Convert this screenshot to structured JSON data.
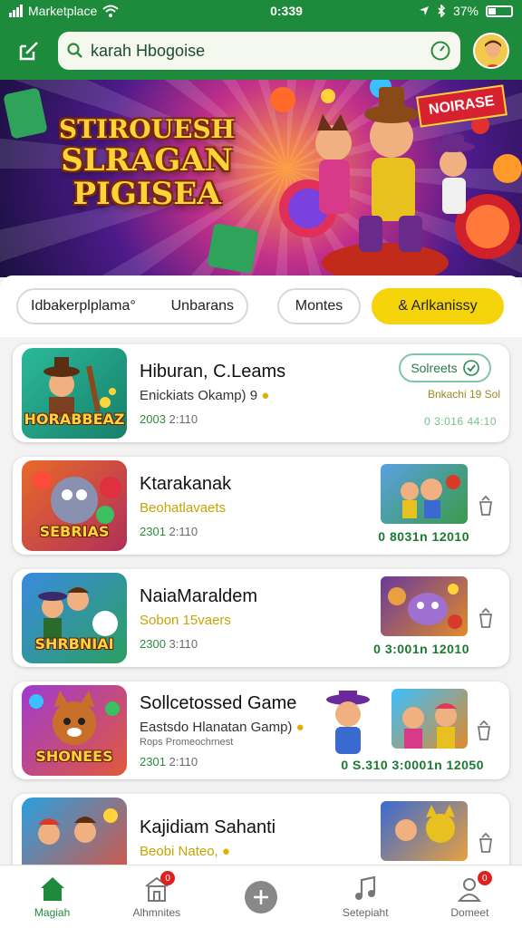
{
  "status_bar": {
    "carrier": "Marketplace",
    "time": "0:339",
    "battery": "37%"
  },
  "header": {
    "search_value": "karah Hbogoise",
    "search_placeholder": "Search"
  },
  "banner": {
    "title_line1": "STIROUESH",
    "title_line2": "SLRAGAN",
    "title_line3": "PIGISEA",
    "tag": "NOIRASE"
  },
  "filters": [
    {
      "label": "Idbakerplplama°",
      "extra": "Unbarans"
    },
    {
      "label": "Montes"
    },
    {
      "label": "& Arlkanissy"
    }
  ],
  "cards": [
    {
      "title": "Hiburan, C.Leams",
      "subtitle": "Enickiats Okamp) 9",
      "meta_date": "2003",
      "meta_time": "2:110",
      "thumb_label": "HORABBEAZ",
      "play_label": "Solreets",
      "side_text": "Bnkachi 19 Sol",
      "stats": "0 3:016  44:10"
    },
    {
      "title": "Ktarakanak",
      "subtitle": "Beohatlavaets",
      "meta_date": "2301",
      "meta_time": "2:110",
      "thumb_label": "SEBRIAS",
      "stats": "0 8031n  12010"
    },
    {
      "title": "NaiaMaraldem",
      "subtitle": "Sobon 15vaers",
      "meta_date": "2300",
      "meta_time": "3:110",
      "thumb_label": "SHRBNIAI",
      "stats": "0 3:001n  12010"
    },
    {
      "title": "Sollcetossed Game",
      "subtitle": "Eastsdo Hlanatan Gamp)",
      "sub2": "Rops Promeochrnest",
      "meta_date": "2301",
      "meta_time": "2:110",
      "thumb_label": "SHONEES",
      "stats": "0 S.310  3:0001n  12050"
    },
    {
      "title": "Kajidiam Sahanti",
      "subtitle": "Beobi Nateo,",
      "thumb_label": ""
    }
  ],
  "bottom_nav": [
    {
      "label": "Magiah",
      "icon": "home-icon",
      "active": true
    },
    {
      "label": "Alhmnites",
      "icon": "store-icon",
      "badge": "0"
    },
    {
      "label": "",
      "icon": "add-icon"
    },
    {
      "label": "Setepiaht",
      "icon": "music-icon"
    },
    {
      "label": "Domeet",
      "icon": "profile-icon",
      "badge": "0"
    }
  ],
  "colors": {
    "brand_green": "#1e8a3c",
    "accent_yellow": "#f5d40c",
    "badge_red": "#e02020"
  }
}
